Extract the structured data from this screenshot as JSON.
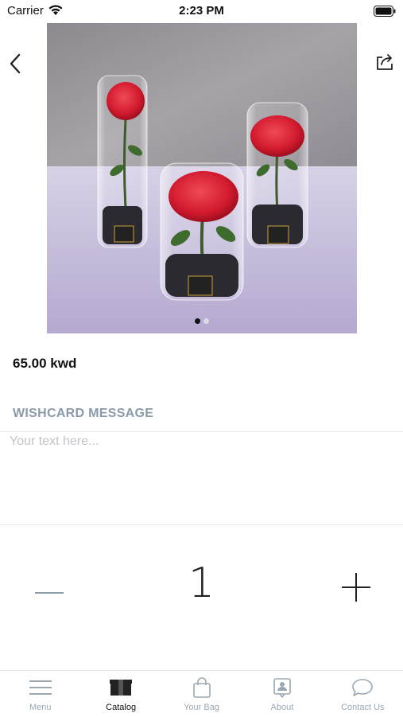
{
  "status_bar": {
    "carrier": "Carrier",
    "time": "2:23 PM"
  },
  "icons": {
    "back": "chevron-left-icon",
    "share": "share-icon"
  },
  "carousel": {
    "page_count": 2,
    "current_page": 1
  },
  "product": {
    "price": "65.00 kwd"
  },
  "wishcard": {
    "title": "WISHCARD MESSAGE",
    "placeholder": "Your text here...",
    "value": ""
  },
  "quantity": {
    "value": "1"
  },
  "tabs": [
    {
      "label": "Menu",
      "icon": "menu-icon",
      "active": false
    },
    {
      "label": "Catalog",
      "icon": "catalog-icon",
      "active": true
    },
    {
      "label": "Your Bag",
      "icon": "bag-icon",
      "active": false
    },
    {
      "label": "About",
      "icon": "about-icon",
      "active": false
    },
    {
      "label": "Contact Us",
      "icon": "chat-icon",
      "active": false
    }
  ],
  "colors": {
    "accent_muted": "#8a9aa8",
    "tab_inactive": "#9aa7b2",
    "tab_active": "#111111"
  }
}
